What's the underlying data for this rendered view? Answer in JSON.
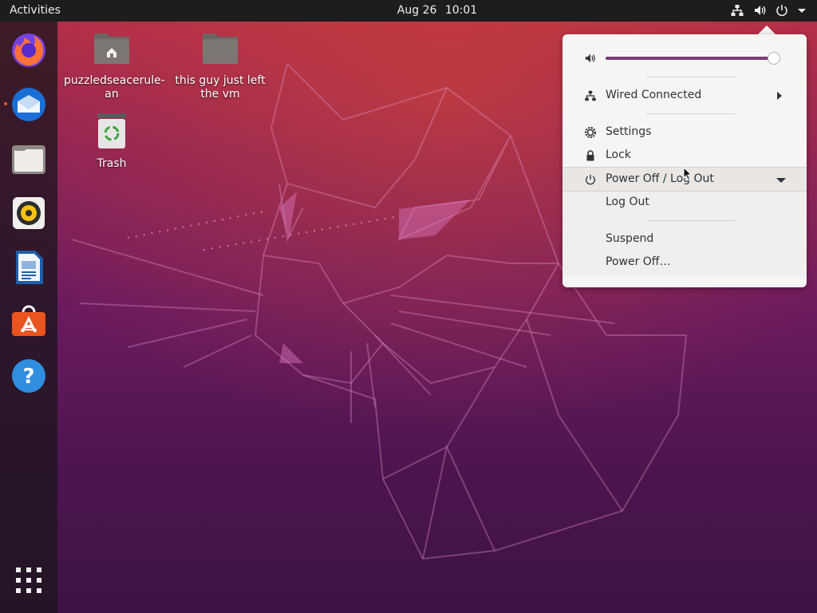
{
  "topbar": {
    "activities": "Activities",
    "date": "Aug 26",
    "time": "10:01",
    "icons": [
      "network-icon",
      "volume-icon",
      "power-icon",
      "dropdown-arrow-icon"
    ]
  },
  "dock": {
    "items": [
      {
        "name": "firefox",
        "running": false
      },
      {
        "name": "thunderbird",
        "running": true
      },
      {
        "name": "files",
        "running": false
      },
      {
        "name": "rhythmbox",
        "running": false
      },
      {
        "name": "libreoffice-writer",
        "running": false
      },
      {
        "name": "ubuntu-software",
        "running": false
      },
      {
        "name": "help",
        "running": false
      }
    ],
    "show_apps": "show-applications"
  },
  "desktop": {
    "icons": [
      {
        "label": "puzzledseacerule-an",
        "type": "home-folder"
      },
      {
        "label": "this guy just left the vm",
        "type": "folder"
      },
      {
        "label": "Trash",
        "type": "trash"
      }
    ]
  },
  "system_menu": {
    "volume_fraction": 0.97,
    "network_label": "Wired Connected",
    "settings_label": "Settings",
    "lock_label": "Lock",
    "power_label": "Power Off / Log Out",
    "logout_label": "Log Out",
    "suspend_label": "Suspend",
    "poweroff_label": "Power Off…"
  },
  "colors": {
    "accent": "#e95420",
    "slider": "#7b3a76",
    "panel": "#1d1d1d"
  }
}
